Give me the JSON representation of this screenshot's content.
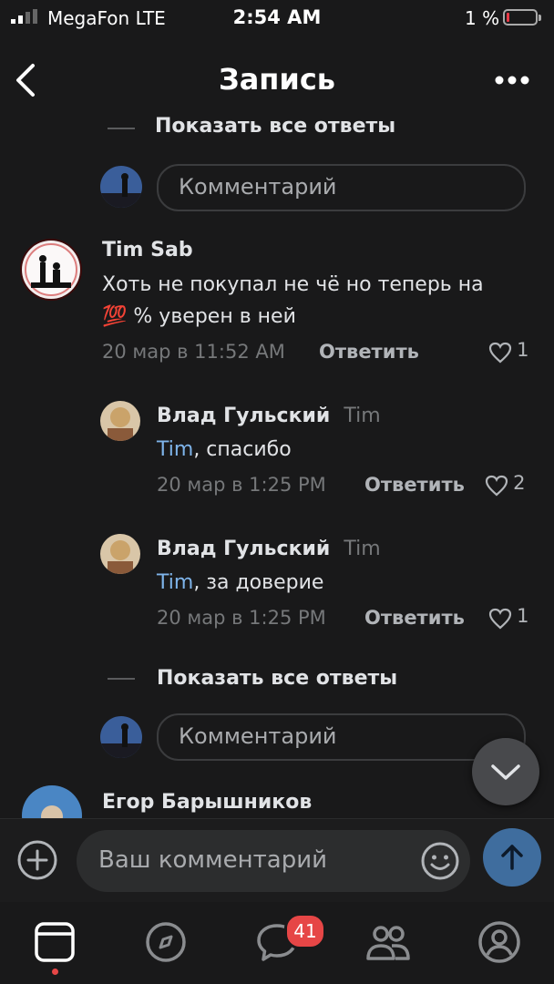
{
  "status_bar": {
    "carrier": "MegaFon  LTE",
    "time": "2:54 AM",
    "battery": "1 %"
  },
  "header": {
    "title": "Запись"
  },
  "thread_top": {
    "show_all_label": "Показать все ответы"
  },
  "comment_input_1": {
    "placeholder": "Комментарий"
  },
  "comments": [
    {
      "author": "Tim Sab",
      "text_line1": "Хоть не покупал не чё но теперь на",
      "emoji": "💯",
      "text_line2": "% уверен в ней",
      "date": "20 мар в 11:52 AM",
      "reply_label": "Ответить",
      "likes": "1"
    }
  ],
  "replies": [
    {
      "author": "Влад Гульский",
      "reply_to": "Tim",
      "mention": "Tim",
      "text": ", спасибо",
      "date": "20 мар в 1:25 PM",
      "reply_label": "Ответить",
      "likes": "2"
    },
    {
      "author": "Влад Гульский",
      "reply_to": "Tim",
      "mention": "Tim",
      "text": ", за доверие",
      "date": "20 мар в 1:25 PM",
      "reply_label": "Ответить",
      "likes": "1"
    }
  ],
  "thread_bottom": {
    "show_all_label": "Показать все ответы"
  },
  "comment_input_2": {
    "placeholder": "Комментарий"
  },
  "next_comment": {
    "author": "Егор Барышников"
  },
  "composer": {
    "placeholder": "Ваш комментарий"
  },
  "tabbar": {
    "messages_badge": "41"
  },
  "colors": {
    "background": "#19191a",
    "link": "#7eb4ea",
    "badge": "#e64646",
    "send_button": "#3f6d9e"
  }
}
